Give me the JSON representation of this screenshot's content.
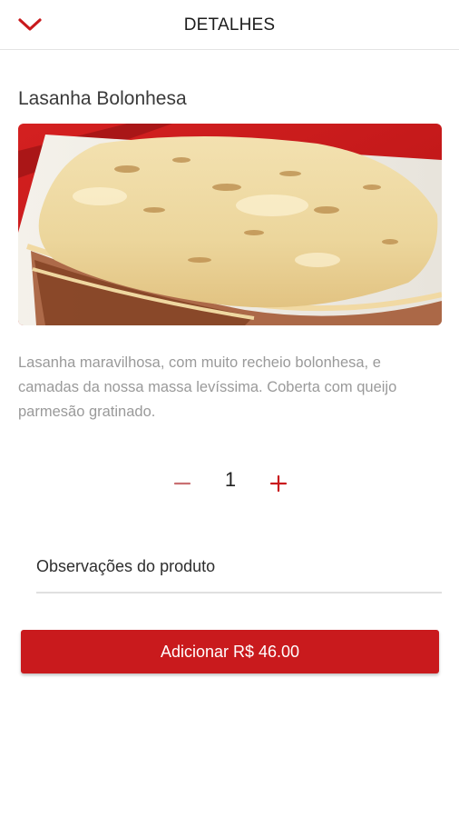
{
  "header": {
    "title": "DETALHES",
    "back_icon": "chevron-down-icon"
  },
  "product": {
    "name": "Lasanha Bolonhesa",
    "description": "Lasanha maravilhosa, com muito recheio bolonhesa, e camadas da nossa massa levíssima. Coberta com queijo parmesão gratinado.",
    "image_subject": "lasagna-photo"
  },
  "quantity": {
    "value": "1",
    "decrement_icon": "minus-icon",
    "increment_icon": "plus-icon"
  },
  "notes": {
    "placeholder": "Observações do produto",
    "value": ""
  },
  "add_button": {
    "label": "Adicionar R$ 46.00"
  },
  "colors": {
    "accent": "#c91a1d",
    "text_primary": "#1d1d1d",
    "text_muted": "#9a9a9a"
  }
}
